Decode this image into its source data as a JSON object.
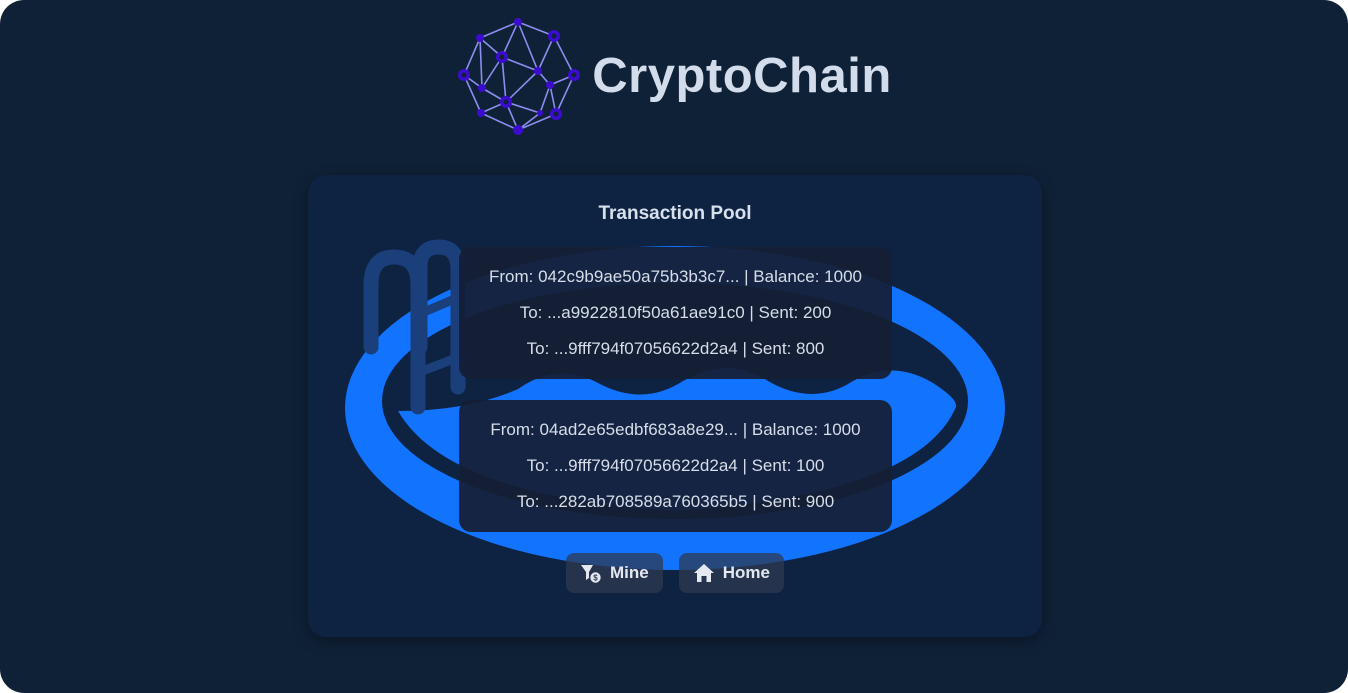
{
  "app": {
    "title": "CryptoChain",
    "logo_icon": "network-globe-logo",
    "colors": {
      "background": "#0f2137",
      "card": "#0e2242",
      "pool_blue": "#1273ff",
      "logo_node": "#3b0ccf",
      "logo_edge": "#8b8df0"
    }
  },
  "pool": {
    "title": "Transaction Pool",
    "background_icon": "swimming-pool-icon",
    "transactions": [
      {
        "from": "From: 042c9b9ae50a75b3b3c7... | Balance: 1000",
        "outputs": [
          "To: ...a9922810f50a61ae91c0 | Sent: 200",
          "To: ...9fff794f07056622d2a4 | Sent: 800"
        ]
      },
      {
        "from": "From: 04ad2e65edbf683a8e29... | Balance: 1000",
        "outputs": [
          "To: ...9fff794f07056622d2a4 | Sent: 100",
          "To: ...282ab708589a760365b5 | Sent: 900"
        ]
      }
    ]
  },
  "actions": {
    "mine_label": "Mine",
    "mine_icon": "mining-cart-icon",
    "home_label": "Home",
    "home_icon": "home-icon"
  }
}
